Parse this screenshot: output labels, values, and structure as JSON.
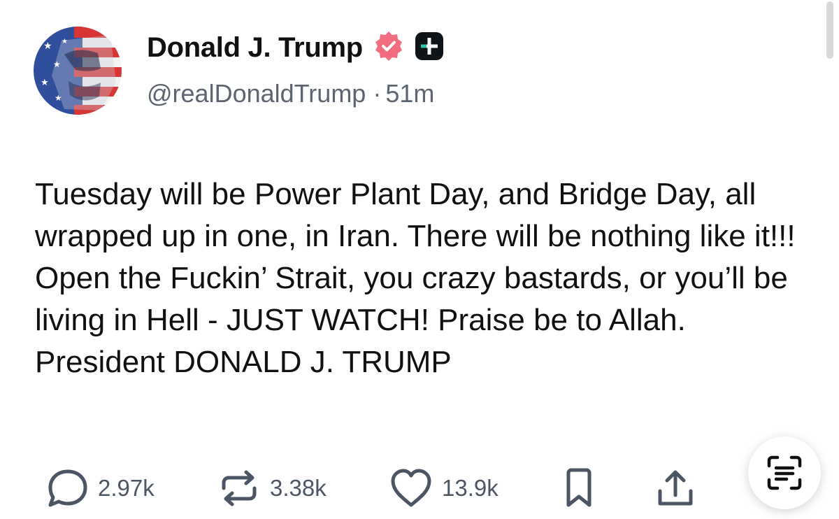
{
  "post": {
    "author": {
      "display_name": "Donald J. Trump",
      "handle": "@realDonaldTrump",
      "verified": true,
      "avatar_icon": "american-flag-portrait-avatar"
    },
    "separator": "·",
    "time_ago": "51m",
    "body": "Tuesday will be Power Plant Day, and Bridge Day, all wrapped up in one, in Iran. There will be nothing like it!!! Open the Fuckin’ Strait, you crazy bastards, or you’ll be living in Hell - JUST WATCH! Praise be to Allah. President DONALD J. TRUMP"
  },
  "actions": {
    "replies": {
      "count": "2.97k",
      "icon": "reply-bubble-icon"
    },
    "retruths": {
      "count": "3.38k",
      "icon": "repost-icon"
    },
    "likes": {
      "count": "13.9k",
      "icon": "heart-icon"
    },
    "bookmark": {
      "icon": "bookmark-icon"
    },
    "share": {
      "icon": "share-upload-icon"
    }
  },
  "overlay": {
    "icon": "text-scan-icon"
  },
  "colors": {
    "verified_badge": "#f26b7f",
    "plus_badge": "#0f1419",
    "plus_badge_accent": "#2ec4a7",
    "text_primary": "#111111",
    "text_secondary": "#5b6470",
    "action_icon": "#4b5563"
  }
}
